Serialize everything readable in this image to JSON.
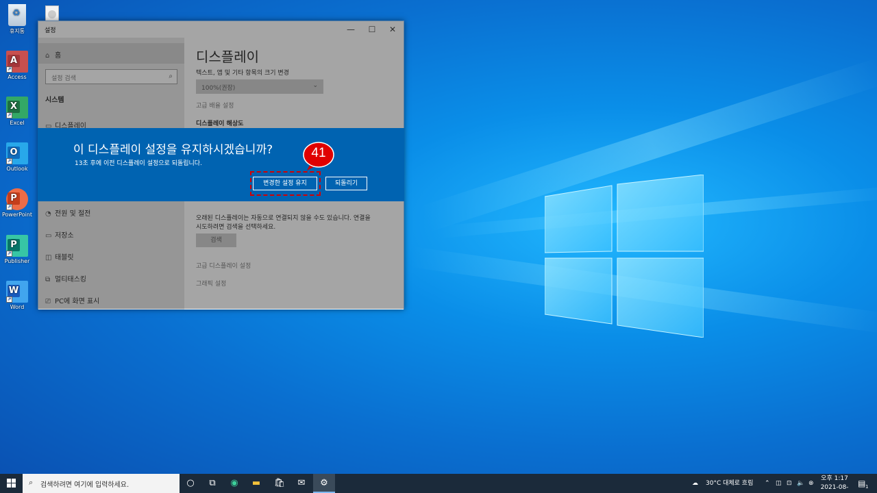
{
  "desktop": {
    "icons": [
      {
        "label": "휴지통",
        "icon": "recycle-bin-icon"
      },
      {
        "label": "Access",
        "icon": "access-icon",
        "letter": "A",
        "color": "#a4373a"
      },
      {
        "label": "Excel",
        "icon": "excel-icon",
        "letter": "X",
        "color": "#1d6f42"
      },
      {
        "label": "Outlook",
        "icon": "outlook-icon",
        "letter": "O",
        "color": "#0f6cbd"
      },
      {
        "label": "PowerPoint",
        "icon": "powerpoint-icon",
        "letter": "P",
        "color": "#c43e1c"
      },
      {
        "label": "Publisher",
        "icon": "publisher-icon",
        "letter": "P",
        "color": "#077568"
      },
      {
        "label": "Word",
        "icon": "word-icon",
        "letter": "W",
        "color": "#185abd"
      }
    ]
  },
  "window": {
    "title": "설정",
    "controls": {
      "minimize": "—",
      "maximize": "☐",
      "close": "✕"
    }
  },
  "sidebar": {
    "home": "홈",
    "search_placeholder": "설정 검색",
    "section": "시스템",
    "items": [
      {
        "label": "디스플레이",
        "icon": "monitor-icon"
      },
      {
        "label": "전원 및 절전",
        "icon": "power-icon"
      },
      {
        "label": "저장소",
        "icon": "storage-icon"
      },
      {
        "label": "태블릿",
        "icon": "tablet-icon"
      },
      {
        "label": "멀티태스킹",
        "icon": "multitasking-icon"
      },
      {
        "label": "PC에 화면 표시",
        "icon": "project-icon"
      }
    ]
  },
  "content": {
    "heading": "디스플레이",
    "scale_label": "텍스트, 앱 및 기타 항목의 크기 변경",
    "scale_value": "100%(권장)",
    "advanced_scale": "고급 배율 설정",
    "resolution_label": "디스플레이 해상도",
    "detect_text_1": "오래된 디스플레이는 자동으로 연결되지 않을 수도 있습니다. 연결을",
    "detect_text_2": "시도하려면 검색을 선택하세요.",
    "detect_button": "검색",
    "advanced_display": "고급 디스플레이 설정",
    "graphics": "그래픽 설정"
  },
  "dialog": {
    "question": "이 디스플레이 설정을 유지하시겠습니까?",
    "countdown": "13초 후에 이전 디스플레이 설정으로 되돌립니다.",
    "keep_button": "변경한 설정 유지",
    "revert_button": "되돌리기"
  },
  "annotation": {
    "step": "41",
    "color": "#d40000"
  },
  "taskbar": {
    "search_placeholder": "검색하려면 여기에 입력하세요.",
    "weather": "30°C 대체로 흐림",
    "time": "오후 1:17",
    "date": "2021-08-14",
    "notification_count": "1"
  }
}
